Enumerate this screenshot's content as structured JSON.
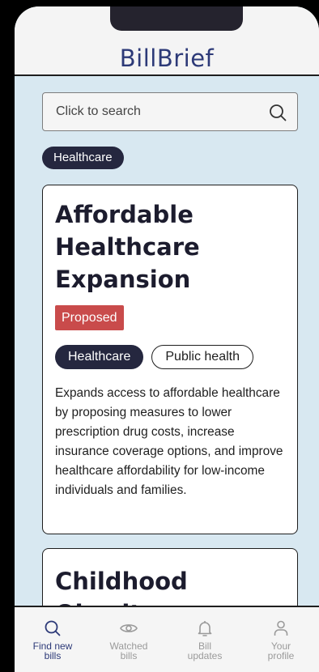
{
  "app": {
    "title": "BillBrief"
  },
  "search": {
    "placeholder": "Click to search"
  },
  "filter": {
    "active_chip": "Healthcare"
  },
  "bills": [
    {
      "title": "Affordable Healthcare Expansion",
      "status": "Proposed",
      "tags": [
        "Healthcare",
        "Public health"
      ],
      "description": "Expands access to affordable healthcare by proposing measures to lower prescription drug costs, increase insurance coverage options, and improve healthcare affordability for low-income individuals and families."
    },
    {
      "title": "Childhood Obesity Prevention Act"
    }
  ],
  "nav": {
    "items": [
      {
        "label_line1": "Find new",
        "label_line2": "bills",
        "icon": "search-icon",
        "active": true
      },
      {
        "label_line1": "Watched",
        "label_line2": "bills",
        "icon": "eye-icon",
        "active": false
      },
      {
        "label_line1": "Bill",
        "label_line2": "updates",
        "icon": "bell-icon",
        "active": false
      },
      {
        "label_line1": "Your",
        "label_line2": "profile",
        "icon": "user-icon",
        "active": false
      }
    ]
  },
  "colors": {
    "accent": "#2d3a78",
    "status_proposed": "#c94b4b",
    "chip_dark": "#25273f",
    "background": "#d8e8f1"
  }
}
